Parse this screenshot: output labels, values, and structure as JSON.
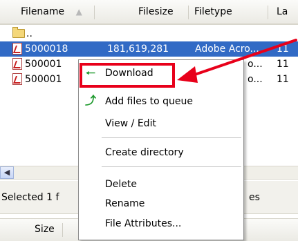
{
  "header": {
    "filename_label": "Filename",
    "sort_arrow": "▲",
    "filesize_label": "Filesize",
    "filetype_label": "Filetype",
    "lastmod_label": "La"
  },
  "rows": [
    {
      "name": "..",
      "size": "",
      "type": "",
      "date": "",
      "icon": "folder-icon"
    },
    {
      "name": "5000018",
      "size": "181,619,281",
      "type": "Adobe Acro...",
      "date": "11",
      "icon": "pdf-file-icon",
      "selected": true
    },
    {
      "name": "500001",
      "size": "",
      "type": "o...",
      "date": "11",
      "icon": "pdf-file-icon"
    },
    {
      "name": "500001",
      "size": "",
      "type": "o...",
      "date": "11",
      "icon": "pdf-file-icon"
    }
  ],
  "status": {
    "text": "Selected 1 f",
    "suffix": "es"
  },
  "bottom_header": {
    "size_label": "Size"
  },
  "context_menu": {
    "items": [
      {
        "label": "Download",
        "icon": "arrow-left-icon"
      },
      {
        "label": "Add files to queue",
        "icon": "add-queue-icon"
      },
      {
        "label": "View / Edit"
      },
      {
        "label": "Create directory"
      },
      {
        "label": "Delete"
      },
      {
        "label": "Rename"
      },
      {
        "label": "File Attributes..."
      }
    ]
  },
  "colors": {
    "selection": "#316ac5",
    "highlight_red": "#e8001a",
    "download_icon": "#1f9a2e"
  }
}
